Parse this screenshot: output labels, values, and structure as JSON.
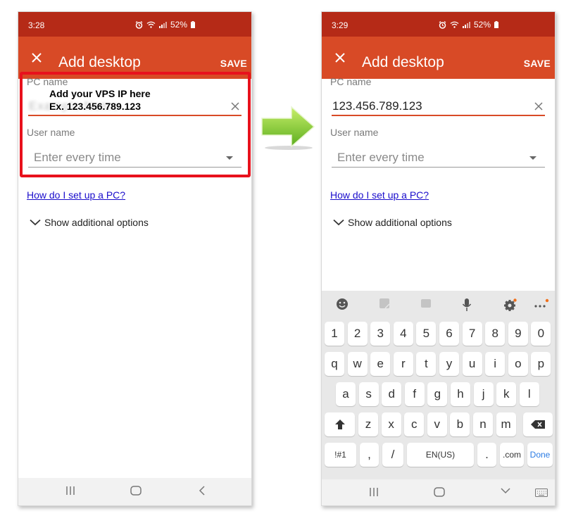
{
  "colors": {
    "status_bar": "#b52a17",
    "app_bar": "#d84a26",
    "accent_underline": "#d84a26",
    "link": "#1a0dcc",
    "annotation": "#e8111c",
    "done_key": "#2a7be4"
  },
  "left": {
    "status": {
      "time": "3:28",
      "battery": "52%"
    },
    "app_bar": {
      "title": "Add desktop",
      "save_label": "SAVE"
    },
    "form": {
      "pc_name_label": "PC name",
      "pc_name_value": "Example Name",
      "user_name_label": "User name",
      "user_name_value": "Enter every time"
    },
    "help_link": "How do I set up a PC?",
    "more_options": "Show additional options"
  },
  "right": {
    "status": {
      "time": "3:29",
      "battery": "52%"
    },
    "app_bar": {
      "title": "Add desktop",
      "save_label": "SAVE"
    },
    "form": {
      "pc_name_label": "PC name",
      "pc_name_value": "123.456.789.123",
      "user_name_label": "User name",
      "user_name_value": "Enter every time"
    },
    "help_link": "How do I set up a PC?",
    "more_options": "Show additional options"
  },
  "annotation": {
    "line1": "Add your VPS IP here",
    "line2": "Ex. 123.456.789.123"
  },
  "keyboard": {
    "toolbar_icons": [
      "emoji-icon",
      "sticker-icon",
      "gif-icon",
      "microphone-icon",
      "gear-icon",
      "more-icon"
    ],
    "row_numbers": [
      "1",
      "2",
      "3",
      "4",
      "5",
      "6",
      "7",
      "8",
      "9",
      "0"
    ],
    "row_q": [
      "q",
      "w",
      "e",
      "r",
      "t",
      "y",
      "u",
      "i",
      "o",
      "p"
    ],
    "row_a": [
      "a",
      "s",
      "d",
      "f",
      "g",
      "h",
      "j",
      "k",
      "l"
    ],
    "row_z": [
      "z",
      "x",
      "c",
      "v",
      "b",
      "n",
      "m"
    ],
    "symbols_label": "!#1",
    "comma_label": ",",
    "slash_label": "/",
    "space_label": "EN(US)",
    "period_label": ".",
    "dotcom_label": ".com",
    "done_label": "Done"
  }
}
